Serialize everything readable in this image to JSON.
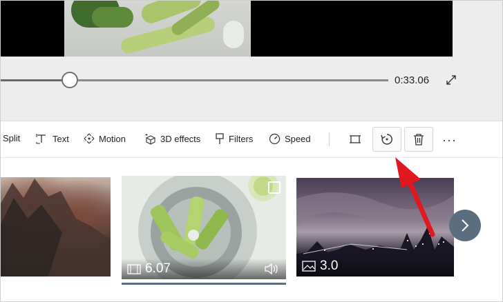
{
  "player": {
    "current_time": "0:33.06",
    "progress": 0.18
  },
  "toolbar": {
    "split_label": "Split",
    "text_label": "Text",
    "motion_label": "Motion",
    "effects3d_label": "3D effects",
    "filters_label": "Filters",
    "speed_label": "Speed",
    "more_label": "···"
  },
  "storyboard": {
    "clips": [
      {
        "name": "clip-mountains",
        "duration": ""
      },
      {
        "name": "clip-blender",
        "duration": "6.07",
        "selected": true
      },
      {
        "name": "clip-city",
        "duration": "3.0"
      }
    ]
  },
  "colors": {
    "accent": "#5a6e80",
    "annotation_arrow": "#e0191f"
  },
  "icons": {
    "fullscreen": "expand-icon",
    "crop": "crop-icon",
    "rotate": "rotate-icon",
    "delete": "trash-icon",
    "next": "chevron-right-icon",
    "video": "film-icon",
    "image": "image-icon",
    "audio": "volume-icon"
  }
}
